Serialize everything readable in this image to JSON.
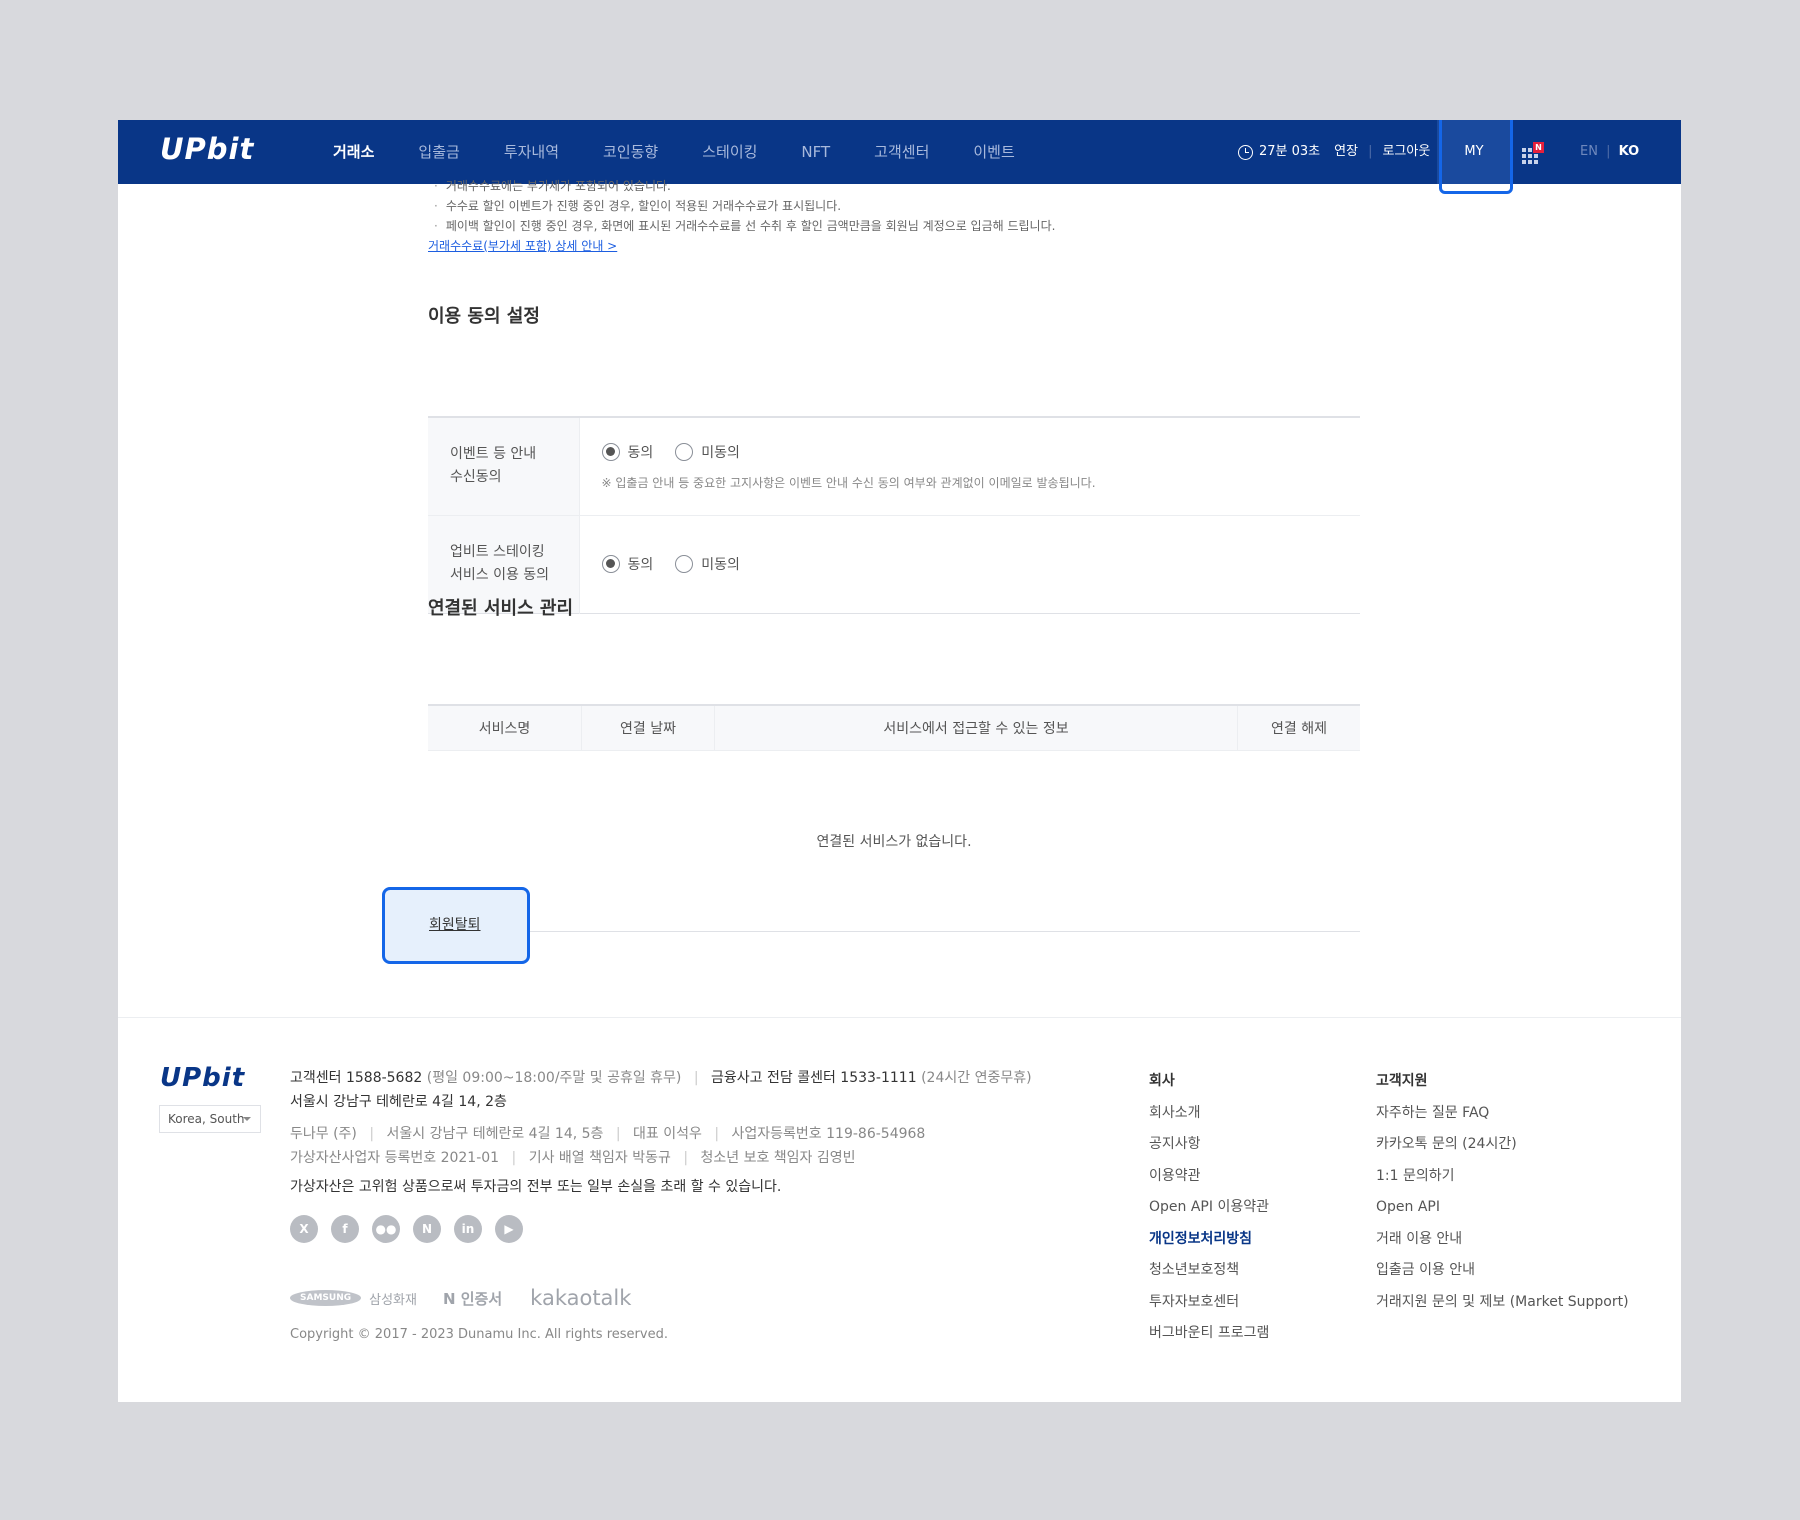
{
  "header": {
    "logo": "UPbit",
    "nav": [
      {
        "label": "거래소",
        "active": true
      },
      {
        "label": "입출금",
        "active": false
      },
      {
        "label": "투자내역",
        "active": false
      },
      {
        "label": "코인동향",
        "active": false
      },
      {
        "label": "스테이킹",
        "active": false
      },
      {
        "label": "NFT",
        "active": false
      },
      {
        "label": "고객센터",
        "active": false
      },
      {
        "label": "이벤트",
        "active": false
      }
    ],
    "timer": "27분 03초",
    "extend": "연장",
    "logout": "로그아웃",
    "my": "MY",
    "badge": "N",
    "lang_en": "EN",
    "lang_ko": "KO"
  },
  "notes": {
    "lines": [
      "거래수수료에는 부가세가 포함되어 있습니다.",
      "수수료 할인 이벤트가 진행 중인 경우, 할인이 적용된 거래수수료가 표시됩니다.",
      "페이백 할인이 진행 중인 경우, 화면에 표시된 거래수수료를 선 수취 후 할인 금액만큼을 회원님 계정으로 입금해 드립니다."
    ],
    "link": "거래수수료(부가세 포함) 상세 안내 >"
  },
  "consent": {
    "title": "이용 동의 설정",
    "rows": [
      {
        "label_1": "이벤트 등 안내",
        "label_2": "수신동의",
        "agree": "동의",
        "disagree": "미동의",
        "selected": "agree",
        "note": "※ 입출금 안내 등 중요한 고지사항은 이벤트 안내 수신 동의 여부와 관계없이 이메일로 발송됩니다."
      },
      {
        "label_1": "업비트 스테이킹",
        "label_2": "서비스 이용 동의",
        "agree": "동의",
        "disagree": "미동의",
        "selected": "agree",
        "note": ""
      }
    ]
  },
  "services": {
    "title": "연결된 서비스 관리",
    "columns": [
      "서비스명",
      "연결 날짜",
      "서비스에서 접근할 수 있는 정보",
      "연결 해제"
    ],
    "empty": "연결된 서비스가 없습니다."
  },
  "withdraw": "회원탈퇴",
  "footer": {
    "logo": "UPbit",
    "country": "Korea, South",
    "cs_label": "고객센터 1588-5682",
    "cs_hours": "(평일 09:00~18:00/주말 및 공휴일 휴무)",
    "fraud_label": "금융사고 전담 콜센터 1533-1111",
    "fraud_hours": "(24시간 연중무휴)",
    "address": "서울시 강남구 테헤란로 4길 14, 2층",
    "company": "두나무 (주)",
    "company_addr": "서울시 강남구 테헤란로 4길 14, 5층",
    "ceo": "대표 이석우",
    "biz_no": "사업자등록번호 119-86-54968",
    "vasp": "가상자산사업자 등록번호 2021-01",
    "editor": "기사 배열 책임자 박동규",
    "youth": "청소년 보호 책임자 김영빈",
    "warning": "가상자산은 고위험 상품으로써 투자금의 전부 또는 일부 손실을 초래 할 수 있습니다.",
    "social": [
      "x-icon",
      "facebook-icon",
      "medium-icon",
      "naver-icon",
      "linkedin-icon",
      "youtube-icon"
    ],
    "partners": {
      "samsung": "SAMSUNG",
      "samsung_fire": "삼성화재",
      "n_cert": "N 인증서",
      "kakaotalk": "kakaotalk"
    },
    "copyright": "Copyright © 2017 - 2023 Dunamu Inc. All rights reserved.",
    "col_company": {
      "title": "회사",
      "items": [
        "회사소개",
        "공지사항",
        "이용약관",
        "Open API 이용약관",
        "개인정보처리방침",
        "청소년보호정책",
        "투자자보호센터",
        "버그바운티 프로그램"
      ]
    },
    "col_support": {
      "title": "고객지원",
      "items": [
        "자주하는 질문 FAQ",
        "카카오톡 문의 (24시간)",
        "1:1 문의하기",
        "Open API",
        "거래 이용 안내",
        "입출금 이용 안내",
        "거래지원 문의 및 제보 (Market Support)"
      ]
    }
  }
}
